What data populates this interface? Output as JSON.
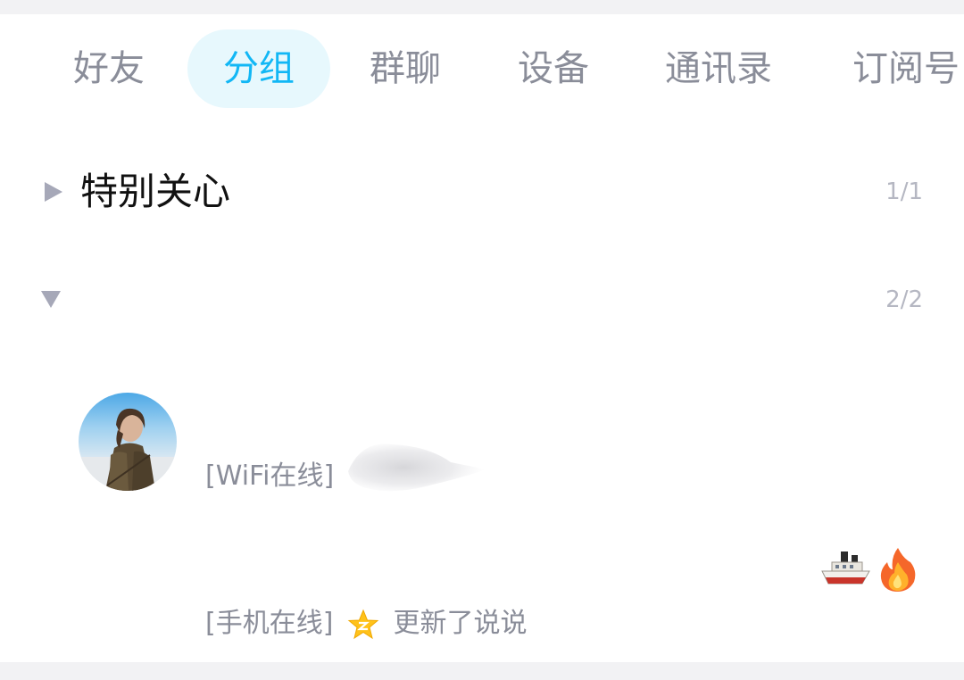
{
  "tabs": [
    {
      "label": "好友",
      "active": false
    },
    {
      "label": "分组",
      "active": true
    },
    {
      "label": "群聊",
      "active": false
    },
    {
      "label": "设备",
      "active": false
    },
    {
      "label": "通讯录",
      "active": false
    },
    {
      "label": "订阅号",
      "active": false
    }
  ],
  "groups": [
    {
      "name": "特别关心",
      "count": "1/1",
      "expanded": false
    },
    {
      "name": "",
      "count": "2/2",
      "expanded": true
    }
  ],
  "contacts": [
    {
      "status": "[WiFi在线]"
    },
    {
      "status": "[手机在线]",
      "update": "更新了说说",
      "badges": [
        "ship-emoji",
        "fire-emoji"
      ]
    }
  ],
  "colors": {
    "accent": "#12b7f5",
    "active_tab_bg": "#e7f8fd",
    "muted_text": "#8a8d99",
    "arrow": "#a6a8b8"
  }
}
